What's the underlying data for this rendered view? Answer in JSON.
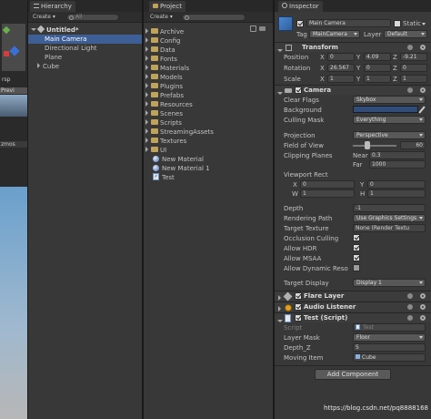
{
  "scene": {
    "label_top": "rsp",
    "label_preview": "Previ",
    "label_gizmos": "zmos"
  },
  "hierarchy": {
    "tab": "Hierarchy",
    "create": "Create",
    "search_placeholder": "All",
    "scene_name": "Untitled*",
    "items": [
      "Main Camera",
      "Directional Light",
      "Plane",
      "Cube"
    ]
  },
  "project": {
    "tab": "Project",
    "create": "Create",
    "folders": [
      "Archive",
      "Config",
      "Data",
      "Fonts",
      "Materials",
      "Models",
      "Plugins",
      "Prefabs",
      "Resources",
      "Scenes",
      "Scripts",
      "StreamingAssets",
      "Textures",
      "UI"
    ],
    "assets": [
      "New Material",
      "New Material 1",
      "Test"
    ]
  },
  "inspector": {
    "tab": "Inspector",
    "object_name": "Main Camera",
    "static_label": "Static",
    "tag_label": "Tag",
    "tag_value": "MainCamera",
    "layer_label": "Layer",
    "layer_value": "Default",
    "transform": {
      "title": "Transform",
      "position_label": "Position",
      "rotation_label": "Rotation",
      "scale_label": "Scale",
      "x": "X",
      "y": "Y",
      "z": "Z",
      "position": [
        "0",
        "4.09",
        "-9.21"
      ],
      "rotation": [
        "26.567",
        "0",
        "0"
      ],
      "scale": [
        "1",
        "1",
        "1"
      ]
    },
    "camera": {
      "title": "Camera",
      "clear_flags_label": "Clear Flags",
      "clear_flags_value": "Skybox",
      "background_label": "Background",
      "background_color": "#2e4d7c",
      "culling_mask_label": "Culling Mask",
      "culling_mask_value": "Everything",
      "projection_label": "Projection",
      "projection_value": "Perspective",
      "fov_label": "Field of View",
      "fov_value": "60",
      "fov_fraction": 0.33,
      "clipping_label": "Clipping Planes",
      "near_label": "Near",
      "near_value": "0.3",
      "far_label": "Far",
      "far_value": "1000",
      "viewport_label": "Viewport Rect",
      "vx_label": "X",
      "vx_value": "0",
      "vy_label": "Y",
      "vy_value": "0",
      "vw_label": "W",
      "vw_value": "1",
      "vh_label": "H",
      "vh_value": "1",
      "depth_label": "Depth",
      "depth_value": "-1",
      "rendering_path_label": "Rendering Path",
      "rendering_path_value": "Use Graphics Settings",
      "target_texture_label": "Target Texture",
      "target_texture_value": "None (Render Textu",
      "occlusion_label": "Occlusion Culling",
      "hdr_label": "Allow HDR",
      "msaa_label": "Allow MSAA",
      "dynres_label": "Allow Dynamic Reso",
      "target_display_label": "Target Display",
      "target_display_value": "Display 1"
    },
    "flare_layer": {
      "title": "Flare Layer"
    },
    "audio_listener": {
      "title": "Audio Listener"
    },
    "test_script": {
      "title": "Test (Script)",
      "script_label": "Script",
      "script_value": "Test",
      "layer_mask_label": "Layer Mask",
      "layer_mask_value": "Floor",
      "depth_z_label": "Depth_Z",
      "depth_z_value": "5",
      "moving_item_label": "Moving Item",
      "moving_item_value": "Cube"
    },
    "add_component": "Add Component"
  },
  "watermark": "https://blog.csdn.net/pq8888168"
}
